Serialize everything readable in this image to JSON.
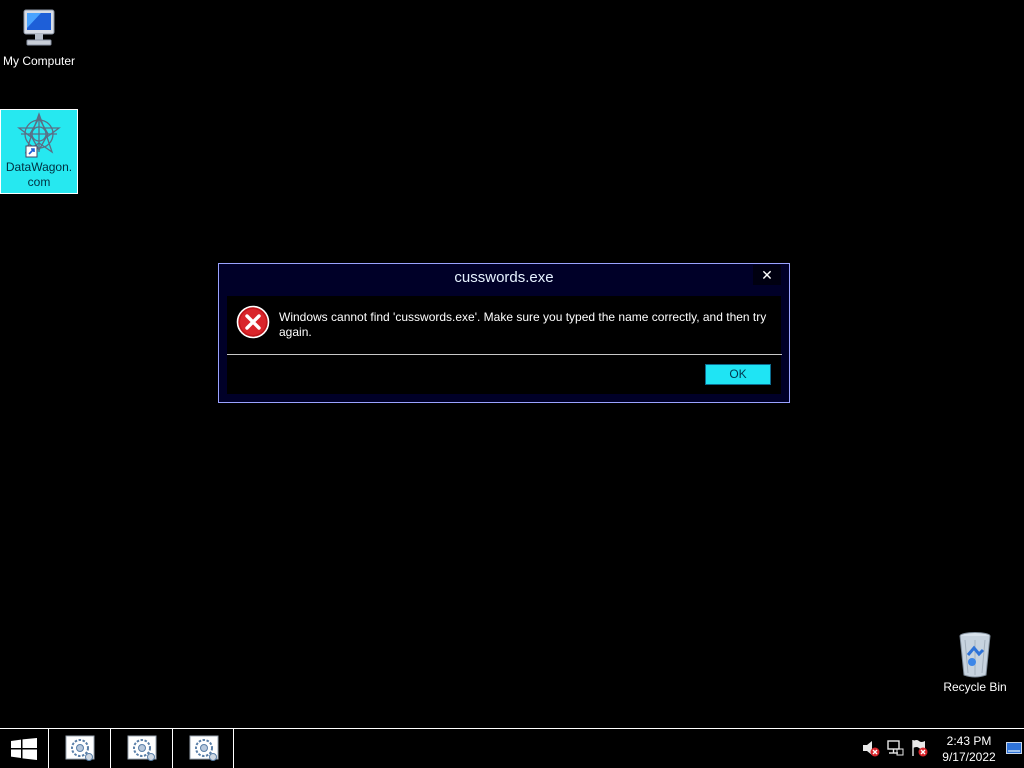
{
  "desktop": {
    "icons": [
      {
        "label": "My Computer",
        "icon": "computer-icon"
      },
      {
        "label": "DataWagon.com",
        "icon": "datawagon-shortcut-icon",
        "selected": true
      },
      {
        "label": "Recycle Bin",
        "icon": "recycle-bin-icon"
      }
    ]
  },
  "dialog": {
    "title": "cusswords.exe",
    "close_label": "✕",
    "icon": "error-icon",
    "message": "Windows cannot find 'cusswords.exe'. Make sure you typed the name correctly, and then try again.",
    "ok_label": "OK"
  },
  "taskbar": {
    "start_icon": "windows-start-icon",
    "buttons": [
      {
        "icon": "app-icon"
      },
      {
        "icon": "app-icon"
      },
      {
        "icon": "app-icon"
      }
    ],
    "tray": [
      "volume-muted-icon",
      "network-icon",
      "action-center-icon"
    ],
    "time": "2:43 PM",
    "date": "9/17/2022"
  },
  "colors": {
    "desktop_bg": "#000000",
    "dialog_bg": "#000028",
    "accent": "#1fe4f4",
    "dialog_border": "#9aa3ff"
  }
}
